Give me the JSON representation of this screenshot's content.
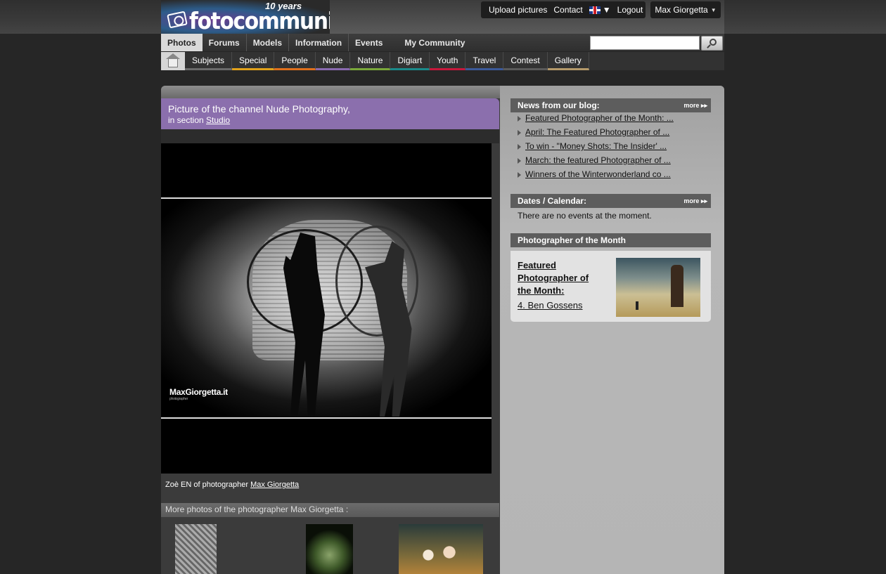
{
  "brand": {
    "logo_text": "fotocommunity",
    "logo_years": "10 years"
  },
  "topnav": {
    "upload": "Upload pictures",
    "contact": "Contact",
    "logout": "Logout",
    "user": "Max Giorgetta"
  },
  "mainnav": {
    "tabs": [
      "Photos",
      "Forums",
      "Models",
      "Information",
      "Events"
    ],
    "my_community": "My Community",
    "search_placeholder": ""
  },
  "subnav": {
    "items": [
      {
        "label": "Subjects",
        "color": "#6b6b6b"
      },
      {
        "label": "Special",
        "color": "#e2a21b"
      },
      {
        "label": "People",
        "color": "#e0701c"
      },
      {
        "label": "Nude",
        "color": "#8a6ab0"
      },
      {
        "label": "Nature",
        "color": "#7aa83a"
      },
      {
        "label": "Digiart",
        "color": "#1a8a8a"
      },
      {
        "label": "Youth",
        "color": "#c8183c"
      },
      {
        "label": "Travel",
        "color": "#3c5a9a"
      },
      {
        "label": "Contest",
        "color": "#5a5a5a"
      },
      {
        "label": "Gallery",
        "color": "#b59a6a"
      }
    ]
  },
  "channel": {
    "title": "Picture of the channel Nude Photography,",
    "section_prefix": "in section",
    "section_link": "Studio"
  },
  "photo": {
    "watermark": "MaxGiorgetta.it",
    "watermark_sub": "photographer",
    "caption_prefix": "Zoè EN of photographer",
    "caption_link": "Max Giorgetta"
  },
  "more_photos": {
    "label": "More photos of the photographer Max Giorgetta :"
  },
  "blog": {
    "title": "News from our blog:",
    "more": "more",
    "items": [
      "Featured Photographer of the Month: ...",
      "April: The Featured Photographer of ...",
      "To win - \"Money Shots: The Insider' ...",
      "March: the featured Photographer of ...",
      " Winners of the Winterwonderland co ..."
    ]
  },
  "calendar": {
    "title": "Dates / Calendar:",
    "more": "more",
    "empty": "There are no events at the moment."
  },
  "potm": {
    "title": "Photographer of the Month",
    "headline": "Featured Photographer of the Month:",
    "name": "4. Ben Gossens"
  }
}
